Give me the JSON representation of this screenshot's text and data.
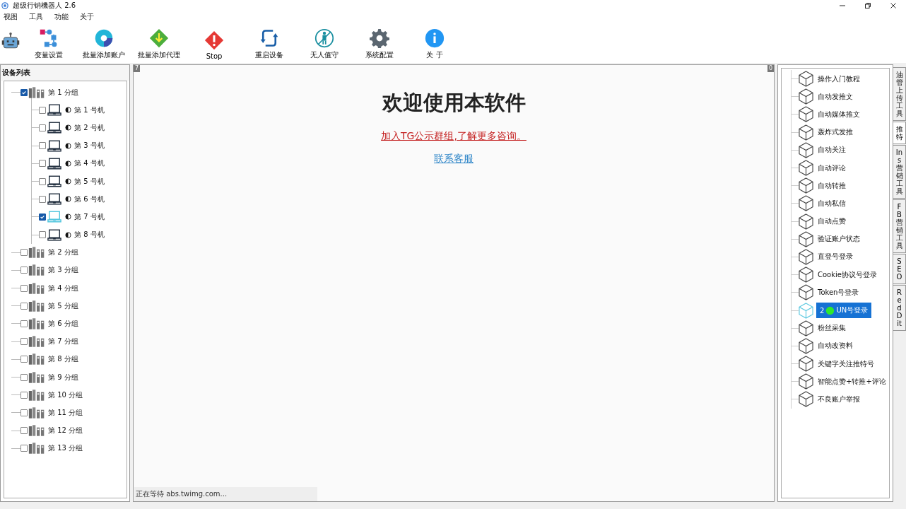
{
  "window": {
    "title": "超级行销機器人 2.6"
  },
  "menu": [
    "视图",
    "工具",
    "功能",
    "关于"
  ],
  "toolbar": [
    {
      "kind": "robot"
    },
    {
      "kind": "variables",
      "label": "变量设置"
    },
    {
      "kind": "accounts",
      "label": "批量添加账户"
    },
    {
      "kind": "proxy",
      "label": "批量添加代理"
    },
    {
      "kind": "stop",
      "label": "Stop"
    },
    {
      "kind": "restart",
      "label": "重启设备"
    },
    {
      "kind": "unattended",
      "label": "无人值守"
    },
    {
      "kind": "settings",
      "label": "系统配置"
    },
    {
      "kind": "about",
      "label": "关 于"
    }
  ],
  "device_list": {
    "title": "设备列表",
    "groups": [
      {
        "label": "第 1 分组",
        "checked": true,
        "expanded": true,
        "children": [
          {
            "label": "第 1 号机",
            "checked": false,
            "selected": false
          },
          {
            "label": "第 2 号机",
            "checked": false,
            "selected": false
          },
          {
            "label": "第 3 号机",
            "checked": false,
            "selected": false
          },
          {
            "label": "第 4 号机",
            "checked": false,
            "selected": false
          },
          {
            "label": "第 5 号机",
            "checked": false,
            "selected": false
          },
          {
            "label": "第 6 号机",
            "checked": false,
            "selected": false
          },
          {
            "label": "第 7 号机",
            "checked": true,
            "selected": true
          },
          {
            "label": "第 8 号机",
            "checked": false,
            "selected": false
          }
        ]
      },
      {
        "label": "第 2 分组",
        "checked": false,
        "expanded": false
      },
      {
        "label": "第 3 分组",
        "checked": false,
        "expanded": false
      },
      {
        "label": "第 4 分组",
        "checked": false,
        "expanded": false
      },
      {
        "label": "第 5 分组",
        "checked": false,
        "expanded": false
      },
      {
        "label": "第 6 分组",
        "checked": false,
        "expanded": false
      },
      {
        "label": "第 7 分组",
        "checked": false,
        "expanded": false
      },
      {
        "label": "第 8 分组",
        "checked": false,
        "expanded": false
      },
      {
        "label": "第 9 分组",
        "checked": false,
        "expanded": false
      },
      {
        "label": "第 10 分组",
        "checked": false,
        "expanded": false
      },
      {
        "label": "第 11 分组",
        "checked": false,
        "expanded": false
      },
      {
        "label": "第 12 分组",
        "checked": false,
        "expanded": false
      },
      {
        "label": "第 13 分组",
        "checked": false,
        "expanded": false
      }
    ]
  },
  "browser": {
    "left_badge": "7",
    "right_badge": "0",
    "heading": "欢迎使用本软件",
    "group_link": "加入TG公示群组,了解更多咨询。",
    "service_link": "联系客服",
    "status": "正在等待 abs.twimg.com..."
  },
  "functions": {
    "items": [
      {
        "label": "操作入门教程",
        "selected": false
      },
      {
        "label": "自动发推文",
        "selected": false
      },
      {
        "label": "自动媒体推文",
        "selected": false
      },
      {
        "label": "轰炸式发推",
        "selected": false
      },
      {
        "label": "自动关注",
        "selected": false
      },
      {
        "label": "自动评论",
        "selected": false
      },
      {
        "label": "自动转推",
        "selected": false
      },
      {
        "label": "自动私信",
        "selected": false
      },
      {
        "label": "自动点赞",
        "selected": false
      },
      {
        "label": "验证账户状态",
        "selected": false
      },
      {
        "label": "直登号登录",
        "selected": false
      },
      {
        "label": "Cookie协议号登录",
        "selected": false
      },
      {
        "label": "Token号登录",
        "selected": false
      },
      {
        "label": "2",
        "label_after_cursor": "UN号登录",
        "selected": true
      },
      {
        "label": "粉丝采集",
        "selected": false
      },
      {
        "label": "自动改资料",
        "selected": false
      },
      {
        "label": "关键字关注推特号",
        "selected": false
      },
      {
        "label": "智能点赞+转推+评论",
        "selected": false
      },
      {
        "label": "不良账户举报",
        "selected": false
      }
    ],
    "tabs": [
      {
        "label": "油管上传工具",
        "selected": false
      },
      {
        "label": "推特",
        "selected": true
      },
      {
        "label": "Ins营销工具",
        "selected": false
      },
      {
        "label": "FB营销工具",
        "selected": false
      },
      {
        "label": "SEO",
        "selected": false
      },
      {
        "label": "RedDit",
        "selected": false
      }
    ]
  }
}
